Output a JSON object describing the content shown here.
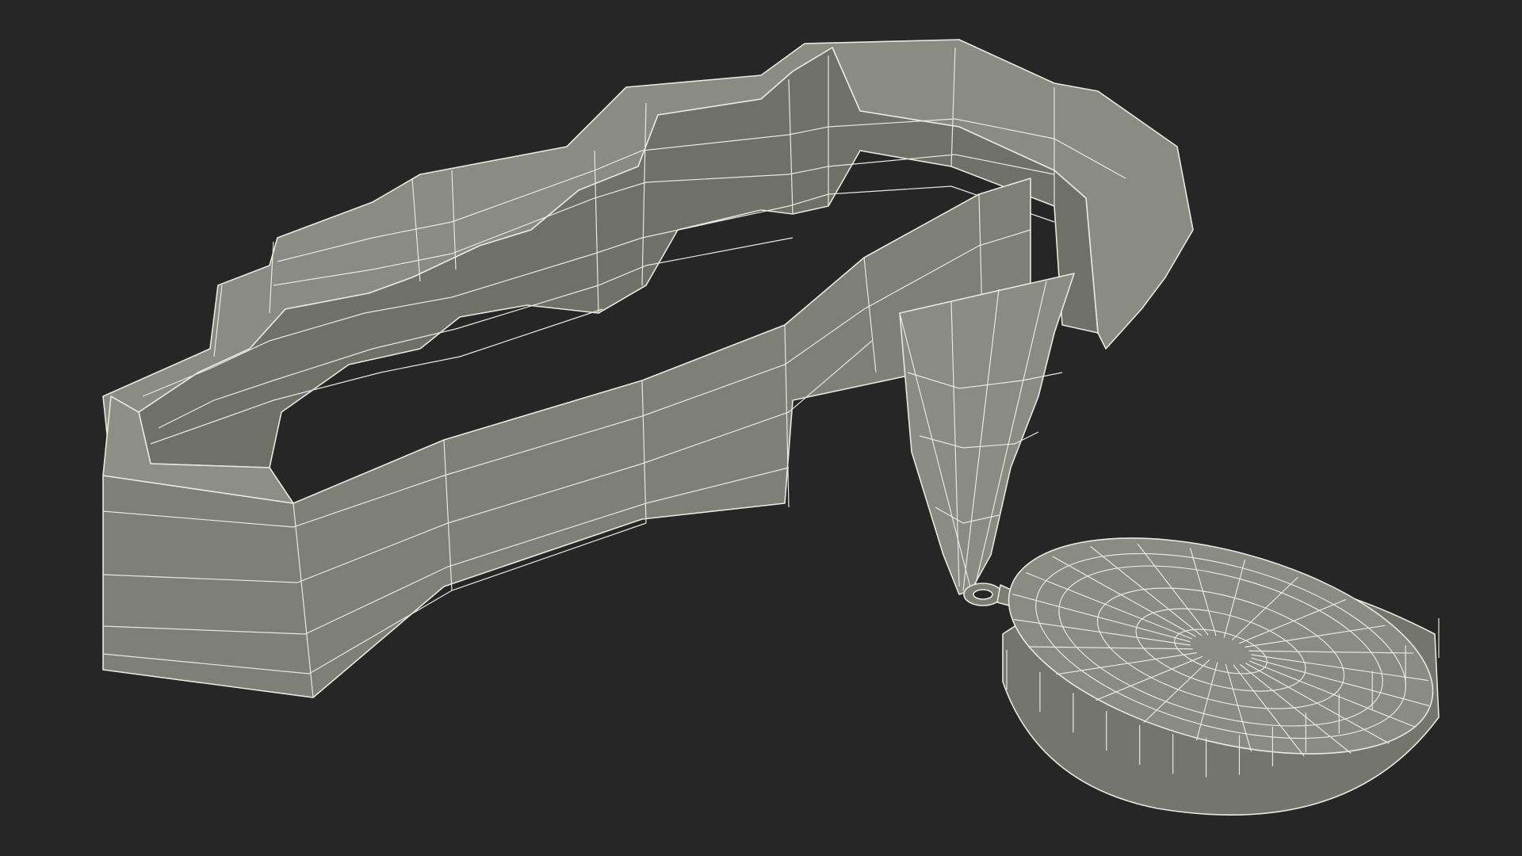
{
  "scene": {
    "description_visible_text": "",
    "background_color": "#262626",
    "mesh_color": "#7c7d73",
    "mesh_shadow_color": "#6a6b62",
    "wire_color": "#e8e8e0"
  }
}
